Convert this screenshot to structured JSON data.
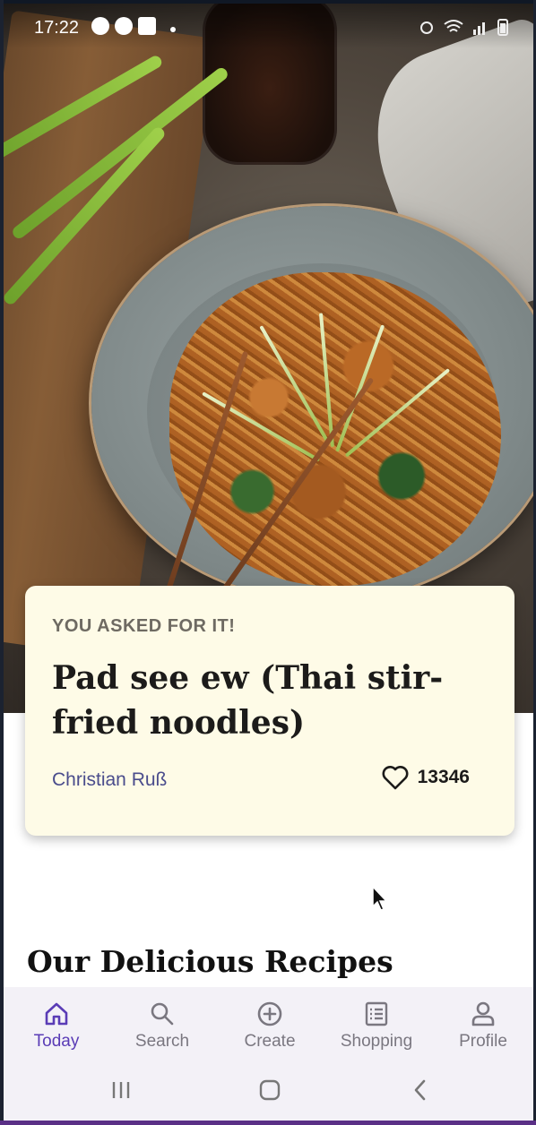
{
  "status_bar": {
    "time": "17:22",
    "left_icons": [
      "messenger-icon",
      "at-sign-icon",
      "gallery-icon",
      "dot-icon"
    ],
    "right_icons": [
      "alarm-icon",
      "wifi-icon",
      "signal-icon",
      "battery-icon"
    ]
  },
  "hero": {
    "image": "pad-see-ew-photo"
  },
  "feature": {
    "kicker": "YOU ASKED FOR IT!",
    "title": "Pad see ew (Thai stir-fried noodles)",
    "author": "Christian Ruß",
    "likes": "13346",
    "like_icon": "heart-outline-icon"
  },
  "section": {
    "title": "Our Delicious Recipes"
  },
  "bottom_nav": {
    "items": [
      {
        "label": "Today",
        "icon": "home-icon",
        "active": true
      },
      {
        "label": "Search",
        "icon": "search-icon",
        "active": false
      },
      {
        "label": "Create",
        "icon": "plus-circle-icon",
        "active": false
      },
      {
        "label": "Shopping",
        "icon": "list-icon",
        "active": false
      },
      {
        "label": "Profile",
        "icon": "person-icon",
        "active": false
      }
    ]
  },
  "system_nav": {
    "buttons": [
      "recent-apps-icon",
      "home-button-icon",
      "back-icon"
    ]
  },
  "colors": {
    "accent": "#5a3cb6",
    "card_background": "#fefbe7",
    "author_link": "#4a4c8c",
    "nav_background": "#f3f1f7"
  }
}
